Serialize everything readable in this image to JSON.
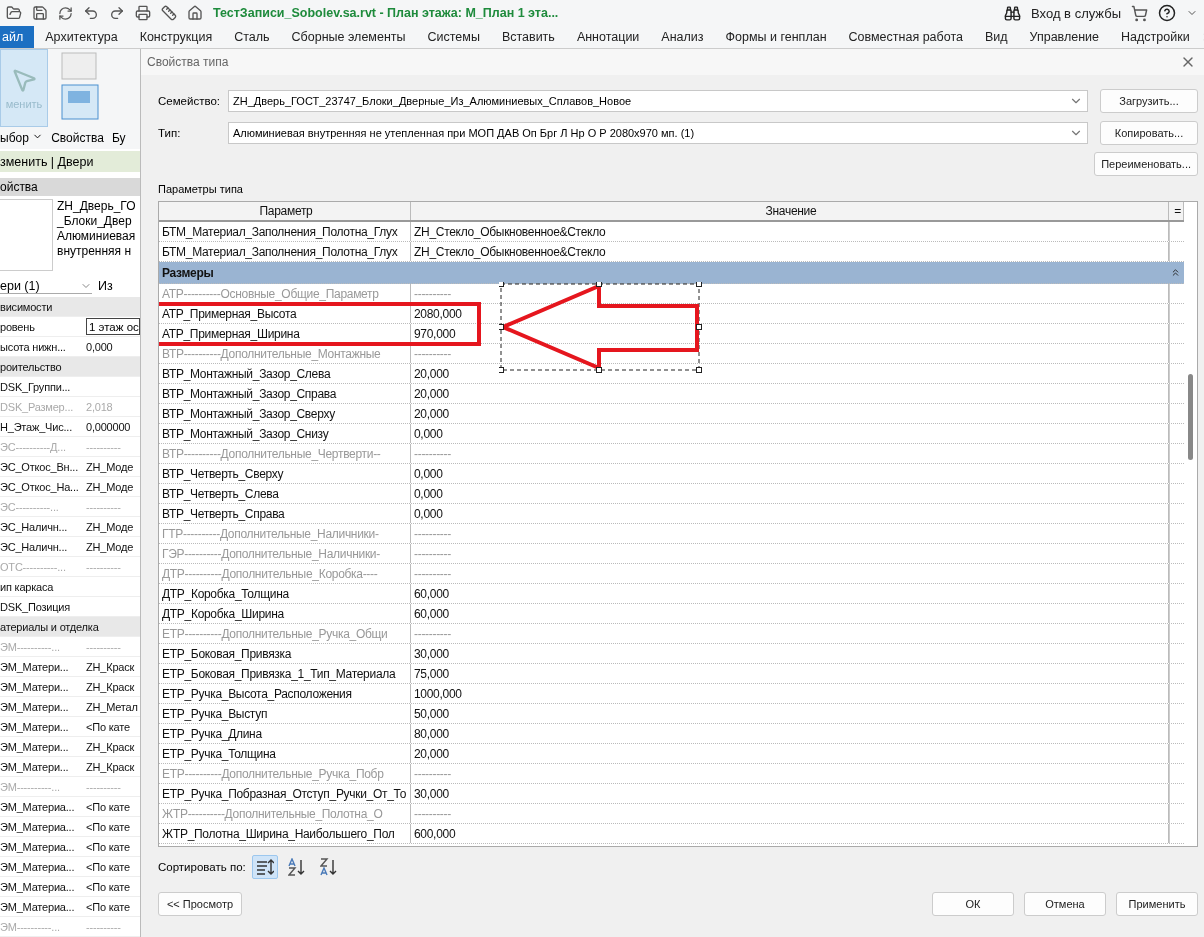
{
  "app": {
    "title": "ТестЗаписи_Sobolev.sa.rvt - План этажа: М_План 1 эта...",
    "sign_in": "Вход в службы"
  },
  "ribbon_tabs": [
    {
      "label": "айл",
      "selected": true
    },
    {
      "label": "Архитектура",
      "selected": false
    },
    {
      "label": "Конструкция",
      "selected": false
    },
    {
      "label": "Сталь",
      "selected": false
    },
    {
      "label": "Сборные элементы",
      "selected": false
    },
    {
      "label": "Системы",
      "selected": false
    },
    {
      "label": "Вставить",
      "selected": false
    },
    {
      "label": "Аннотации",
      "selected": false
    },
    {
      "label": "Анализ",
      "selected": false
    },
    {
      "label": "Формы и генплан",
      "selected": false
    },
    {
      "label": "Совместная работа",
      "selected": false
    },
    {
      "label": "Вид",
      "selected": false
    },
    {
      "label": "Управление",
      "selected": false
    },
    {
      "label": "Надстройки",
      "selected": false
    }
  ],
  "left_panel": {
    "modify_button": {
      "label": "менить",
      "selected": true
    },
    "select_label": "ыбор",
    "properties_label": "Свойства",
    "build_label": "Бу",
    "context_bar": "зменить | Двери",
    "header": "ойства",
    "type_lines": [
      "ZH_Дверь_ГО",
      "_Блоки_Двер",
      "Алюминиевая",
      "внутренняя н"
    ],
    "filter": "ери (1)",
    "edit_type": "Из",
    "rows": [
      {
        "kind": "group",
        "name": "висимости"
      },
      {
        "kind": "field",
        "name": "ровень",
        "value": "1 этаж ос"
      },
      {
        "kind": "param",
        "name": "ысота нижн...",
        "value": "0,000"
      },
      {
        "kind": "group",
        "name": "роительство"
      },
      {
        "kind": "param",
        "name": "DSK_Группи..."
      },
      {
        "kind": "readonly",
        "name": "DSK_Размер...",
        "value": "2,018"
      },
      {
        "kind": "param",
        "name": "Н_Этаж_Чис...",
        "value": "0,000000"
      },
      {
        "kind": "separator",
        "name": "ЭС----------Д...",
        "value": "----------"
      },
      {
        "kind": "param",
        "name": "ЭС_Откос_Вн...",
        "value": "ZH_Моде"
      },
      {
        "kind": "param",
        "name": "ЭС_Откос_На...",
        "value": "ZH_Моде"
      },
      {
        "kind": "separator",
        "name": "ЭС----------...",
        "value": "----------"
      },
      {
        "kind": "param",
        "name": "ЭС_Наличн...",
        "value": "ZH_Моде"
      },
      {
        "kind": "param",
        "name": "ЭС_Наличн...",
        "value": "ZH_Моде"
      },
      {
        "kind": "separator",
        "name": "ОТС----------...",
        "value": "----------"
      },
      {
        "kind": "param",
        "name": "ип каркаса"
      },
      {
        "kind": "param",
        "name": "DSK_Позиция"
      },
      {
        "kind": "group",
        "name": "атериалы и отделка"
      },
      {
        "kind": "separator",
        "name": "ЭМ----------...",
        "value": "----------"
      },
      {
        "kind": "param",
        "name": "ЭМ_Матери...",
        "value": "ZH_Краск"
      },
      {
        "kind": "param",
        "name": "ЭМ_Матери...",
        "value": "ZH_Краск"
      },
      {
        "kind": "param",
        "name": "ЭМ_Матери...",
        "value": "ZH_Метал"
      },
      {
        "kind": "param",
        "name": "ЭМ_Матери...",
        "value": "<По кате"
      },
      {
        "kind": "param",
        "name": "ЭМ_Матери...",
        "value": "ZH_Краск"
      },
      {
        "kind": "param",
        "name": "ЭМ_Матери...",
        "value": "ZH_Краск"
      },
      {
        "kind": "separator",
        "name": "ЭМ----------...",
        "value": "----------"
      },
      {
        "kind": "param",
        "name": "ЭМ_Материа...",
        "value": "<По кате"
      },
      {
        "kind": "param",
        "name": "ЭМ_Материа...",
        "value": "<По кате"
      },
      {
        "kind": "param",
        "name": "ЭМ_Материа...",
        "value": "<По кате"
      },
      {
        "kind": "param",
        "name": "ЭМ_Материа...",
        "value": "<По кате"
      },
      {
        "kind": "param",
        "name": "ЭМ_Материа...",
        "value": "<По кате"
      },
      {
        "kind": "param",
        "name": "ЭМ_Материа...",
        "value": "<По кате"
      },
      {
        "kind": "separator",
        "name": "ЭМ----------...",
        "value": "----------"
      }
    ]
  },
  "dialog": {
    "title": "Свойства типа",
    "family": {
      "label": "Семейство:",
      "value": "ZH_Дверь_ГОСТ_23747_Блоки_Дверные_Из_Алюминиевых_Сплавов_Новое",
      "button": "Загрузить..."
    },
    "type": {
      "label": "Тип:",
      "value": "Алюминиевая внутренняя не утепленная при МОП ДАВ Оп Брг Л Нр О Р 2080x970 мп. (1)",
      "button": "Копировать..."
    },
    "rename_button": "Переименовать...",
    "params_label": "Параметры типа",
    "columns": [
      "Параметр",
      "Значение",
      "="
    ],
    "rows": [
      {
        "kind": "param",
        "name": "БТМ_Материал_Заполнения_Полотна_Глух",
        "value": "ZH_Стекло_Обыкновенное&Стекло"
      },
      {
        "kind": "param",
        "name": "БТМ_Материал_Заполнения_Полотна_Глух",
        "value": "ZH_Стекло_Обыкновенное&Стекло"
      },
      {
        "kind": "group",
        "name": "Размеры"
      },
      {
        "kind": "separator",
        "name": "АТР----------Основные_Общие_Параметр",
        "value": "----------"
      },
      {
        "kind": "param",
        "name": "АТР_Примерная_Высота",
        "value": "2080,000"
      },
      {
        "kind": "param",
        "name": "АТР_Примерная_Ширина",
        "value": "970,000"
      },
      {
        "kind": "separator",
        "name": "ВТР----------Дополнительные_Монтажные",
        "value": "----------"
      },
      {
        "kind": "param",
        "name": "ВТР_Монтажный_Зазор_Слева",
        "value": "20,000"
      },
      {
        "kind": "param",
        "name": "ВТР_Монтажный_Зазор_Справа",
        "value": "20,000"
      },
      {
        "kind": "param",
        "name": "ВТР_Монтажный_Зазор_Сверху",
        "value": "20,000"
      },
      {
        "kind": "param",
        "name": "ВТР_Монтажный_Зазор_Снизу",
        "value": "0,000"
      },
      {
        "kind": "separator",
        "name": "ВТР----------Дополнительные_Чертверти--",
        "value": "----------"
      },
      {
        "kind": "param",
        "name": "ВТР_Четверть_Сверху",
        "value": "0,000"
      },
      {
        "kind": "param",
        "name": "ВТР_Четверть_Слева",
        "value": "0,000"
      },
      {
        "kind": "param",
        "name": "ВТР_Четверть_Справа",
        "value": "0,000"
      },
      {
        "kind": "separator",
        "name": "ГТР----------Дополнительные_Наличники-",
        "value": "----------"
      },
      {
        "kind": "separator",
        "name": "ГЭР----------Дополнительные_Наличники-",
        "value": "----------"
      },
      {
        "kind": "separator",
        "name": "ДТР----------Дополнительные_Коробка----",
        "value": "----------"
      },
      {
        "kind": "param",
        "name": "ДТР_Коробка_Толщина",
        "value": "60,000"
      },
      {
        "kind": "param",
        "name": "ДТР_Коробка_Ширина",
        "value": "60,000"
      },
      {
        "kind": "separator",
        "name": "ЕТР----------Дополнительные_Ручка_Общи",
        "value": "----------"
      },
      {
        "kind": "param",
        "name": "ЕТР_Боковая_Привязка",
        "value": "30,000"
      },
      {
        "kind": "param",
        "name": "ЕТР_Боковая_Привязка_1_Тип_Материала",
        "value": "75,000"
      },
      {
        "kind": "param",
        "name": "ЕТР_Ручка_Высота_Расположения",
        "value": "1000,000"
      },
      {
        "kind": "param",
        "name": "ЕТР_Ручка_Выступ",
        "value": "50,000"
      },
      {
        "kind": "param",
        "name": "ЕТР_Ручка_Длина",
        "value": "80,000"
      },
      {
        "kind": "param",
        "name": "ЕТР_Ручка_Толщина",
        "value": "20,000"
      },
      {
        "kind": "separator",
        "name": "ЕТР----------Дополнительные_Ручка_Побр",
        "value": "----------"
      },
      {
        "kind": "param",
        "name": "ЕТР_Ручка_Побразная_Отступ_Ручки_От_То",
        "value": "30,000"
      },
      {
        "kind": "separator",
        "name": "ЖТР----------Дополнительные_Полотна_О",
        "value": "----------"
      },
      {
        "kind": "param",
        "name": "ЖТР_Полотна_Ширина_Наибольшего_Пол",
        "value": "600,000"
      }
    ],
    "sort_label": "Сортировать по:",
    "sort_options": [
      {
        "kind": "group",
        "selected": true
      },
      {
        "kind": "ascending",
        "selected": false
      },
      {
        "kind": "descending",
        "selected": false
      }
    ],
    "preview_button": "<< Просмотр",
    "footer_buttons": [
      "ОК",
      "Отмена",
      "Применить"
    ]
  }
}
